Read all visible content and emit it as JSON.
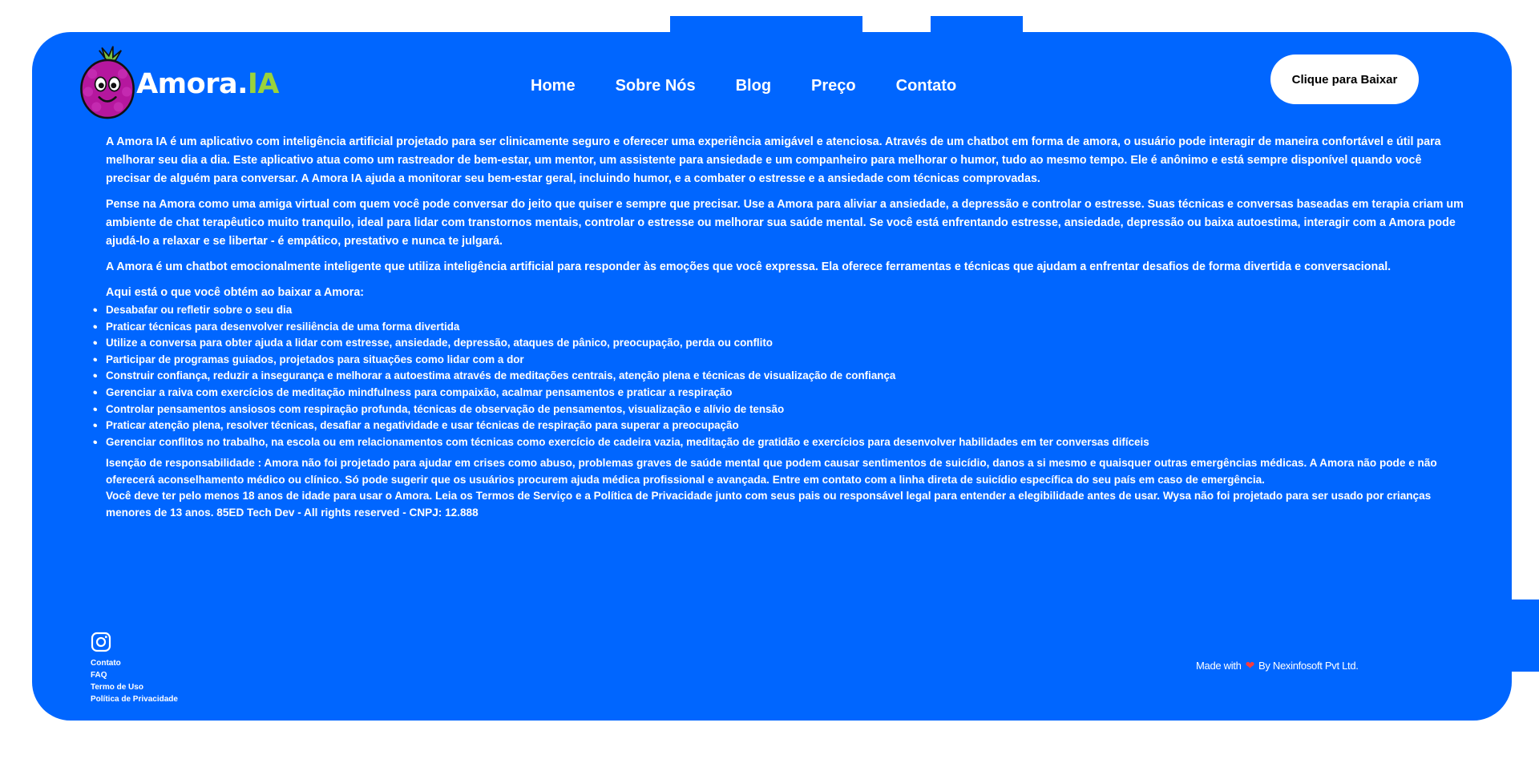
{
  "brand": {
    "name_main": "Amora.",
    "name_accent": "IA",
    "accent_color": "#9ad33b",
    "bg_color": "#0066ff"
  },
  "nav": {
    "items": [
      {
        "label": "Home"
      },
      {
        "label": "Sobre Nós"
      },
      {
        "label": "Blog"
      },
      {
        "label": "Preço"
      },
      {
        "label": "Contato"
      }
    ]
  },
  "header": {
    "download_label": "Clique para Baixar"
  },
  "content": {
    "paragraphs": [
      "A Amora IA é um aplicativo com inteligência artificial projetado para ser clinicamente seguro e oferecer uma experiência amigável e atenciosa. Através de um chatbot em forma de amora, o usuário pode interagir de maneira confortável e útil para melhorar seu dia a dia. Este aplicativo atua como um rastreador de bem-estar, um mentor, um assistente para ansiedade e um companheiro para melhorar o humor, tudo ao mesmo tempo. Ele é anônimo e está sempre disponível quando você precisar de alguém para conversar. A Amora IA ajuda a monitorar seu bem-estar geral, incluindo humor, e a combater o estresse e a ansiedade com técnicas comprovadas.",
      "Pense na Amora como uma amiga virtual com quem você pode conversar do jeito que quiser e sempre que precisar. Use a Amora para aliviar a ansiedade, a depressão e controlar o estresse. Suas técnicas e conversas baseadas em terapia criam um ambiente de chat terapêutico muito tranquilo, ideal para lidar com transtornos mentais, controlar o estresse ou melhorar sua saúde mental. Se você está enfrentando estresse, ansiedade, depressão ou baixa autoestima, interagir com a Amora pode ajudá-lo a relaxar e se libertar - é empático, prestativo e nunca te julgará.",
      "A Amora é um chatbot emocionalmente inteligente que utiliza inteligência artificial para responder às emoções que você expressa. Ela oferece ferramentas e técnicas que ajudam a enfrentar desafios de forma divertida e conversacional."
    ],
    "list_intro": "Aqui está o que você obtém ao baixar a Amora:",
    "bullets": [
      "Desabafar ou refletir sobre o seu dia",
      "Praticar técnicas para desenvolver resiliência de uma forma divertida",
      "Utilize a conversa para obter ajuda a lidar com estresse, ansiedade, depressão, ataques de pânico, preocupação, perda ou conflito",
      "Participar de programas guiados, projetados para situações como lidar com a dor",
      "Construir confiança, reduzir a insegurança e melhorar a autoestima através de meditações centrais, atenção plena e técnicas de visualização de confiança",
      "Gerenciar a raiva com exercícios de meditação mindfulness para compaixão, acalmar pensamentos e praticar a respiração",
      "Controlar pensamentos ansiosos com respiração profunda, técnicas de observação de pensamentos, visualização e alívio de tensão",
      "Praticar atenção plena, resolver técnicas, desafiar a negatividade e usar técnicas de respiração para superar a preocupação",
      "Gerenciar conflitos no trabalho, na escola ou em relacionamentos com técnicas como exercício de cadeira vazia, meditação de gratidão e exercícios para desenvolver habilidades em ter conversas difíceis"
    ],
    "disclaimer": "Isenção de responsabilidade : Amora não foi projetado para ajudar em crises como abuso, problemas graves de saúde mental que podem causar sentimentos de suicídio, danos a si mesmo e quaisquer outras emergências médicas. A Amora não pode e não oferecerá aconselhamento médico ou clínico. Só pode sugerir que os usuários procurem ajuda médica profissional e avançada. Entre em contato com a linha direta de suicídio específica do seu país em caso de emergência.",
    "age_notice": "Você deve ter pelo menos 18 anos de idade para usar o Amora. Leia os Termos de Serviço e a Política de Privacidade junto com seus pais ou responsável legal para entender a elegibilidade antes de usar. Wysa não foi projetado para ser usado por crianças menores de 13 anos. 85ED Tech Dev - All rights reserved - CNPJ: 12.888"
  },
  "footer": {
    "social_icon": "instagram-icon",
    "links": [
      "Contato",
      "FAQ",
      "Termo de Uso",
      "Política de Privacidade"
    ],
    "made_with_prefix": "Made with",
    "made_with_suffix": "By Nexinfosoft Pvt Ltd.",
    "heart_color": "#ff3b3b"
  }
}
